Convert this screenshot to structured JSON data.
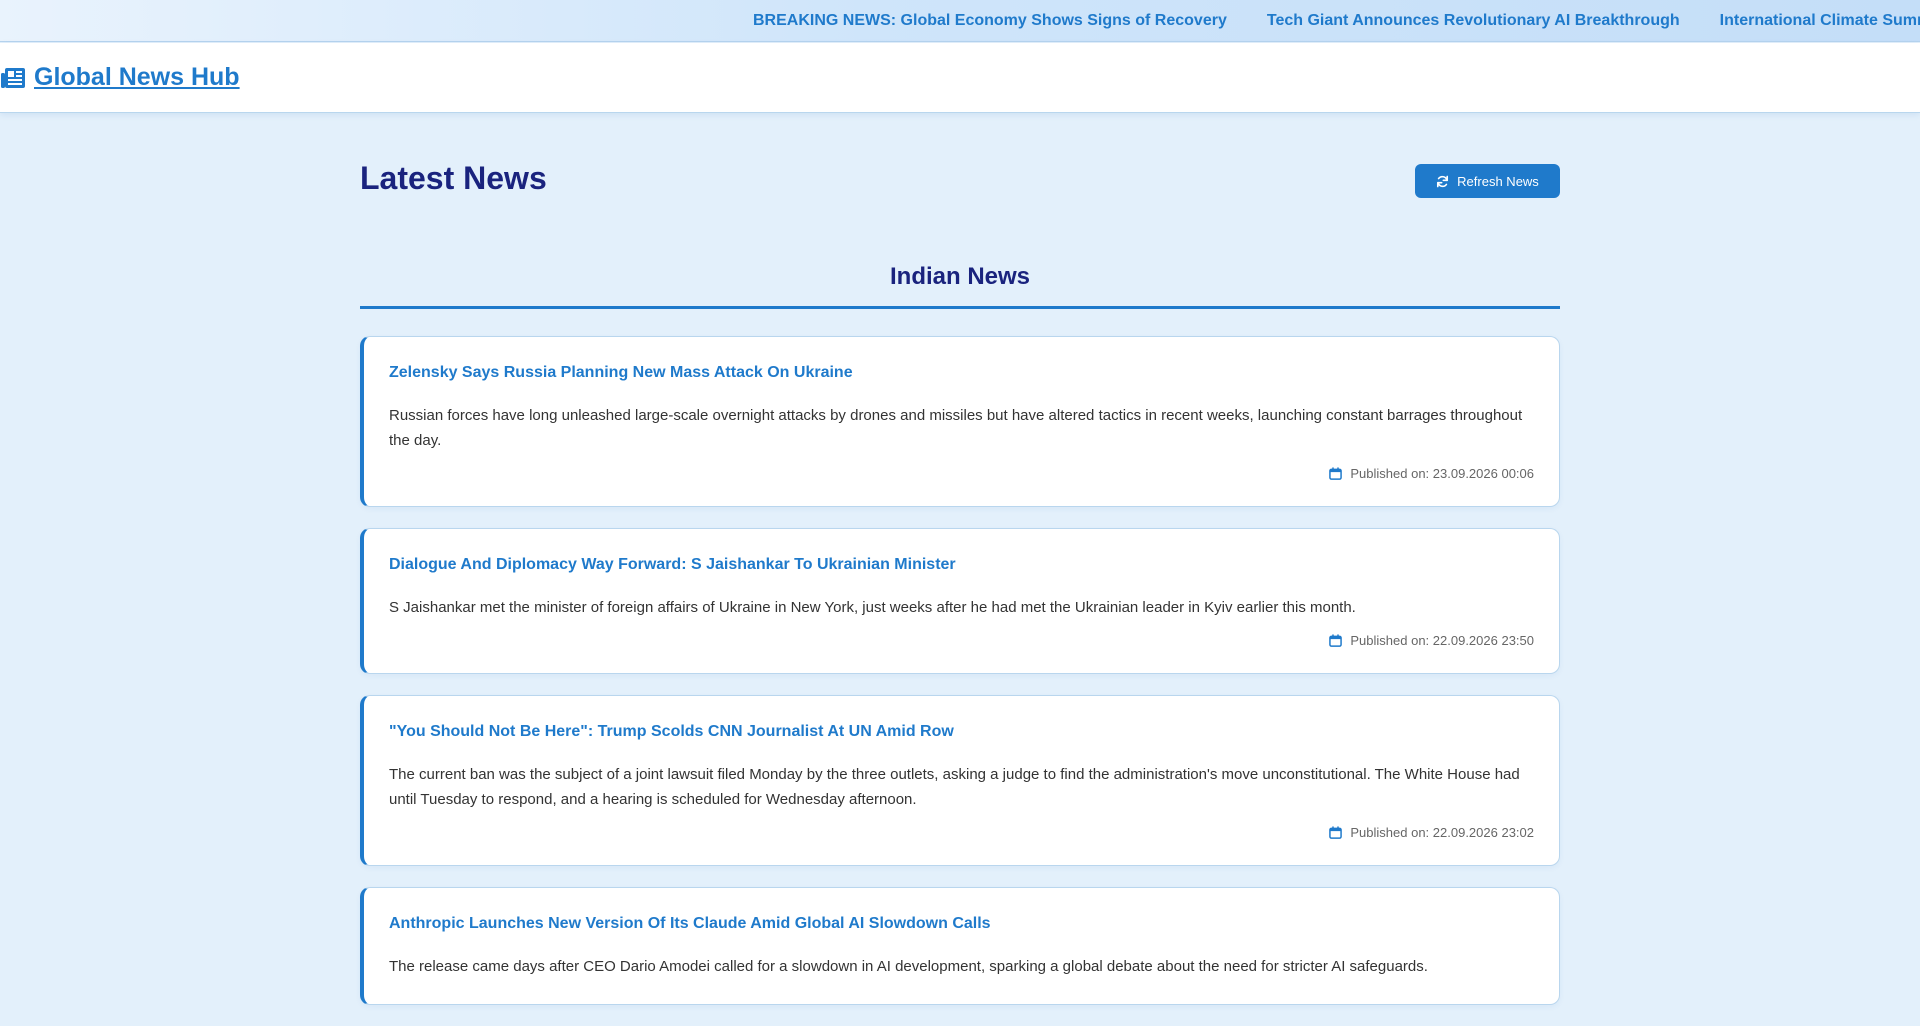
{
  "ticker": {
    "items": [
      "BREAKING NEWS: Global Economy Shows Signs of Recovery",
      "Tech Giant Announces Revolutionary AI Breakthrough",
      "International Climate Summit Reaches Historic Agreement"
    ]
  },
  "navbar": {
    "brand_icon": "newspaper-icon",
    "brand": "Global News Hub"
  },
  "main": {
    "title": "Latest News",
    "refresh_label": "Refresh News",
    "refresh_icon": "sync-icon",
    "section_title": "Indian News"
  },
  "articles": [
    {
      "title": "Zelensky Says Russia Planning New Mass Attack On Ukraine",
      "description": "Russian forces have long unleashed large-scale overnight attacks by drones and missiles but have altered tactics in recent weeks, launching constant barrages throughout the day.",
      "published": "Published on: 23.09.2026 00:06"
    },
    {
      "title": "Dialogue And Diplomacy Way Forward: S Jaishankar To Ukrainian Minister",
      "description": "S Jaishankar met the minister of foreign affairs of Ukraine in New York, just weeks after he had met the Ukrainian leader in Kyiv earlier this month.",
      "published": "Published on: 22.09.2026 23:50"
    },
    {
      "title": "\"You Should Not Be Here\": Trump Scolds CNN Journalist At UN Amid Row",
      "description": "The current ban was the subject of a joint lawsuit filed Monday by the three outlets, asking a judge to find the administration's move unconstitutional. The White House had until Tuesday to respond, and a hearing is scheduled for Wednesday afternoon.",
      "published": "Published on: 22.09.2026 23:02"
    },
    {
      "title": "Anthropic Launches New Version Of Its Claude Amid Global AI Slowdown Calls",
      "description": "The release came days after CEO Dario Amodei called for a slowdown in AI development, sparking a global debate about the need for stricter AI safeguards.",
      "published": ""
    }
  ],
  "colors": {
    "accent": "#1f7acb",
    "heading": "#1a237e",
    "background": "#e3f0fb"
  }
}
